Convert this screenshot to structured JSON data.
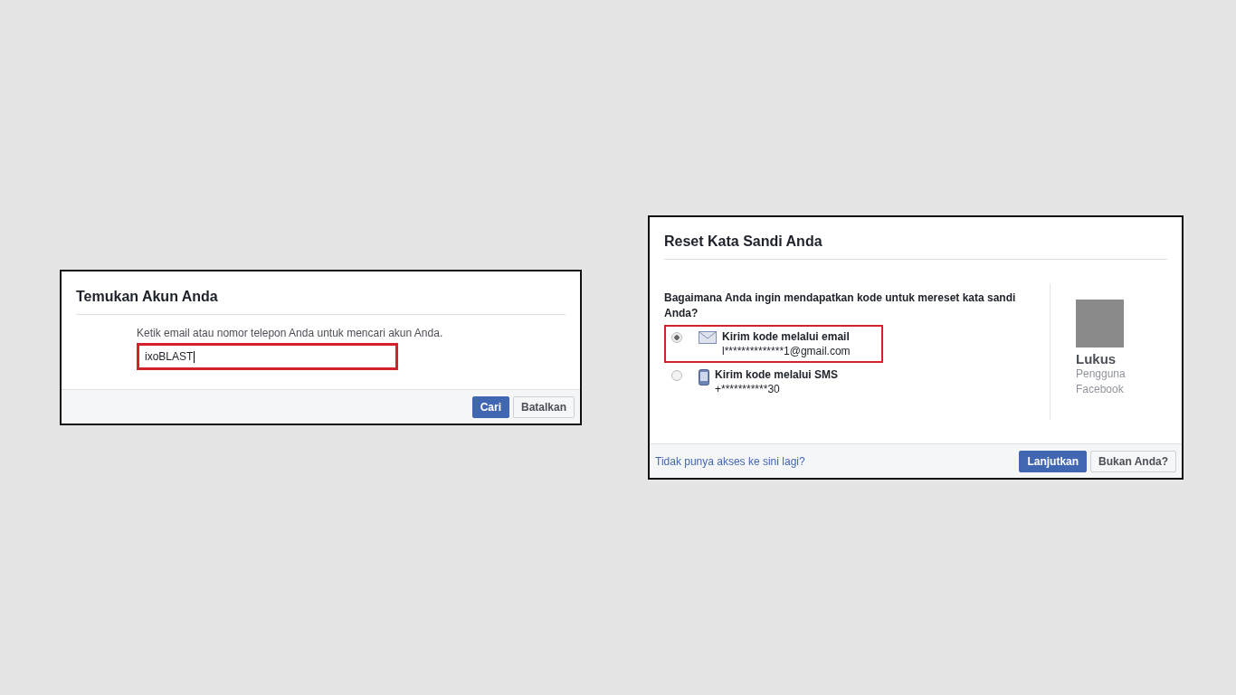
{
  "find_dialog": {
    "title": "Temukan Akun Anda",
    "instruction": "Ketik email atau nomor telepon Anda untuk mencari akun Anda.",
    "field": {
      "value": "ixoBLAST",
      "highlighted": true
    },
    "buttons": [
      {
        "label": "Cari",
        "kind": "primary"
      },
      {
        "label": "Batalkan",
        "kind": "secondary"
      }
    ]
  },
  "reset_dialog": {
    "title": "Reset Kata Sandi Anda",
    "question": "Bagaimana Anda ingin mendapatkan kode untuk mereset kata sandi Anda?",
    "options": [
      {
        "kind": "email",
        "label": "Kirim kode melalui email",
        "detail": "l**************1@gmail.com",
        "selected": true,
        "highlighted": true
      },
      {
        "kind": "sms",
        "label": "Kirim kode melalui SMS",
        "detail": "+***********30",
        "selected": false,
        "highlighted": false
      }
    ],
    "profile": {
      "name": "Lukus",
      "subtitle": "Pengguna Facebook"
    },
    "link": "Tidak punya akses ke sini lagi?",
    "buttons": [
      {
        "label": "Lanjutkan",
        "kind": "primary"
      },
      {
        "label": "Bukan Anda?",
        "kind": "secondary"
      }
    ]
  }
}
